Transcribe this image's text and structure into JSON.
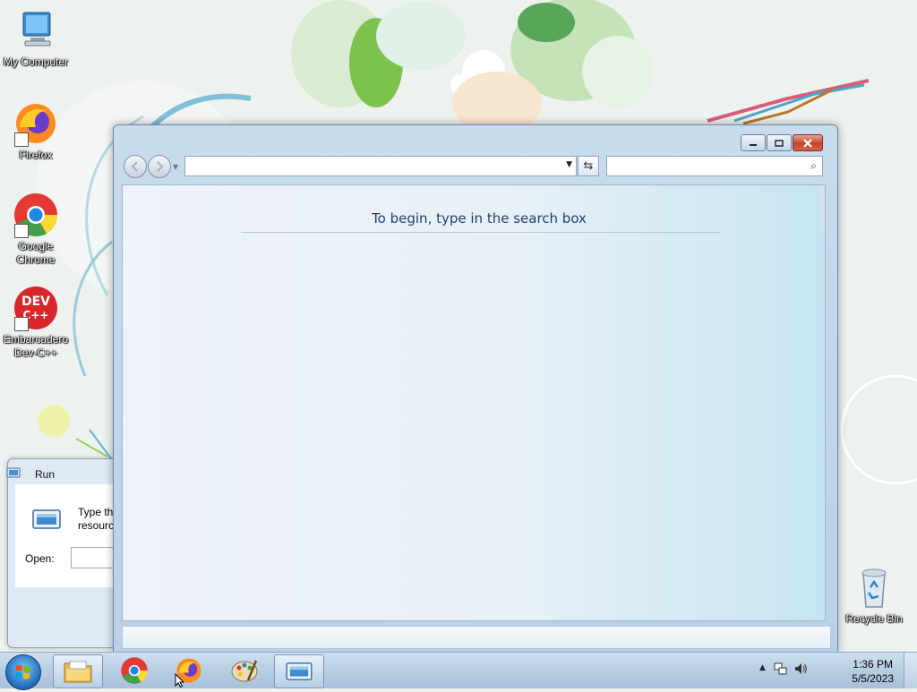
{
  "desktop": {
    "icons": [
      {
        "label": "My Computer",
        "icon": "computer-icon"
      },
      {
        "label": "Firefox",
        "icon": "firefox-icon"
      },
      {
        "label": "Google Chrome",
        "icon": "chrome-icon"
      },
      {
        "label": "Embarcadero Dev-C++",
        "icon": "devcpp-icon"
      },
      {
        "label": "Recycle Bin",
        "icon": "recycle-bin-icon"
      }
    ],
    "devcpp_badge": "DEV",
    "devcpp_badge2": "C++"
  },
  "run_dialog": {
    "title": "Run",
    "description_line1": "Type the",
    "description_line2": "resource,",
    "open_label": "Open:",
    "open_value": ""
  },
  "explorer": {
    "address_value": "",
    "search_placeholder": "",
    "empty_message": "To begin, type in the search box"
  },
  "taskbar": {
    "items": [
      {
        "name": "Windows Explorer",
        "icon": "folder-icon",
        "active": true
      },
      {
        "name": "Google Chrome",
        "icon": "chrome-icon",
        "active": false
      },
      {
        "name": "Firefox",
        "icon": "firefox-icon",
        "active": false
      },
      {
        "name": "Paint",
        "icon": "paint-palette-icon",
        "active": false
      },
      {
        "name": "Run",
        "icon": "run-icon",
        "active": true
      }
    ],
    "clock_time": "1:36 PM",
    "clock_date": "5/5/2023"
  },
  "colors": {
    "accent": "#1f3f73",
    "window_frame": "#c9dcee",
    "taskbar": "#b6cde2"
  }
}
